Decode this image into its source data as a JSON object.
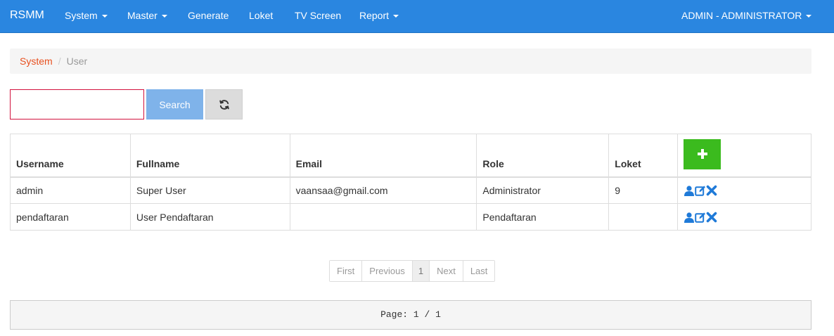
{
  "navbar": {
    "brand": "RSMM",
    "items": [
      {
        "label": "System",
        "dropdown": true
      },
      {
        "label": "Master",
        "dropdown": true
      },
      {
        "label": "Generate",
        "dropdown": false
      },
      {
        "label": "Loket",
        "dropdown": false
      },
      {
        "label": "TV Screen",
        "dropdown": false
      },
      {
        "label": "Report",
        "dropdown": true
      }
    ],
    "user_menu": "ADMIN - ADMINISTRATOR",
    "background": "#2a86e0"
  },
  "breadcrumb": {
    "parent": "System",
    "current": "User"
  },
  "search": {
    "value": "",
    "button_label": "Search",
    "refresh_icon": "refresh-icon"
  },
  "table": {
    "headers": [
      "Username",
      "Fullname",
      "Email",
      "Role",
      "Loket"
    ],
    "add_icon": "plus-icon",
    "rows": [
      {
        "username": "admin",
        "fullname": "Super User",
        "email": "vaansaa@gmail.com",
        "role": "Administrator",
        "loket": "9"
      },
      {
        "username": "pendaftaran",
        "fullname": "User Pendaftaran",
        "email": "",
        "role": "Pendaftaran",
        "loket": ""
      }
    ],
    "row_action_icons": [
      "user-icon",
      "edit-icon",
      "delete-icon"
    ]
  },
  "pagination": {
    "first": "First",
    "previous": "Previous",
    "current": "1",
    "next": "Next",
    "last": "Last"
  },
  "footer": {
    "page_info": "Page: 1 / 1"
  },
  "colors": {
    "accent": "#2a86e0",
    "add_button": "#3bbb1e",
    "action_icon": "#1f7ad8",
    "breadcrumb_link": "#e8501f"
  }
}
